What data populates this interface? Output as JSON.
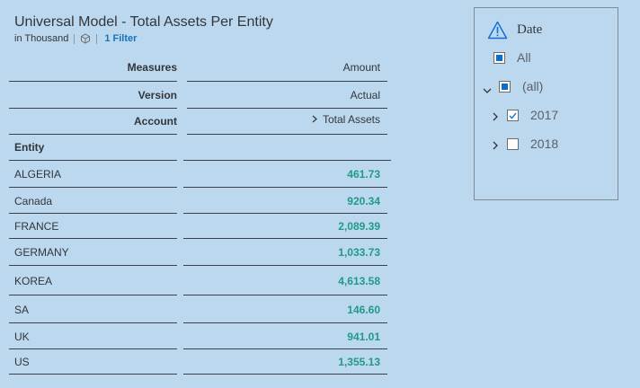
{
  "header": {
    "title": "Universal Model - Total Assets Per Entity",
    "scale": "in Thousand",
    "filter_label": "1 Filter"
  },
  "table": {
    "measures_label": "Measures",
    "measures_value": "Amount",
    "version_label": "Version",
    "version_value": "Actual",
    "account_label": "Account",
    "account_value": "Total Assets",
    "entity_label": "Entity",
    "rows": [
      {
        "entity": "ALGERIA",
        "amount": "461.73"
      },
      {
        "entity": "Canada",
        "amount": "920.34"
      },
      {
        "entity": "FRANCE",
        "amount": "2,089.39"
      },
      {
        "entity": "GERMANY",
        "amount": "1,033.73"
      },
      {
        "entity": "KOREA",
        "amount": "4,613.58"
      },
      {
        "entity": "SA",
        "amount": "146.60"
      },
      {
        "entity": "UK",
        "amount": "941.01"
      },
      {
        "entity": "US",
        "amount": "1,355.13"
      }
    ]
  },
  "filter_panel": {
    "title": "Date",
    "all_label": "All",
    "group_label": "(all)",
    "items": [
      {
        "label": "2017",
        "checked": true
      },
      {
        "label": "2018",
        "checked": false
      }
    ]
  },
  "icons": {
    "warning": "warning-triangle-icon",
    "cube": "cube-icon",
    "expand": "chevron-right-icon",
    "collapse": "chevron-down-icon"
  },
  "colors": {
    "background": "#bcd8ee",
    "value_green": "#1f9a86",
    "link_blue": "#1a73b8",
    "checkbox_blue": "#0a6ed1"
  }
}
